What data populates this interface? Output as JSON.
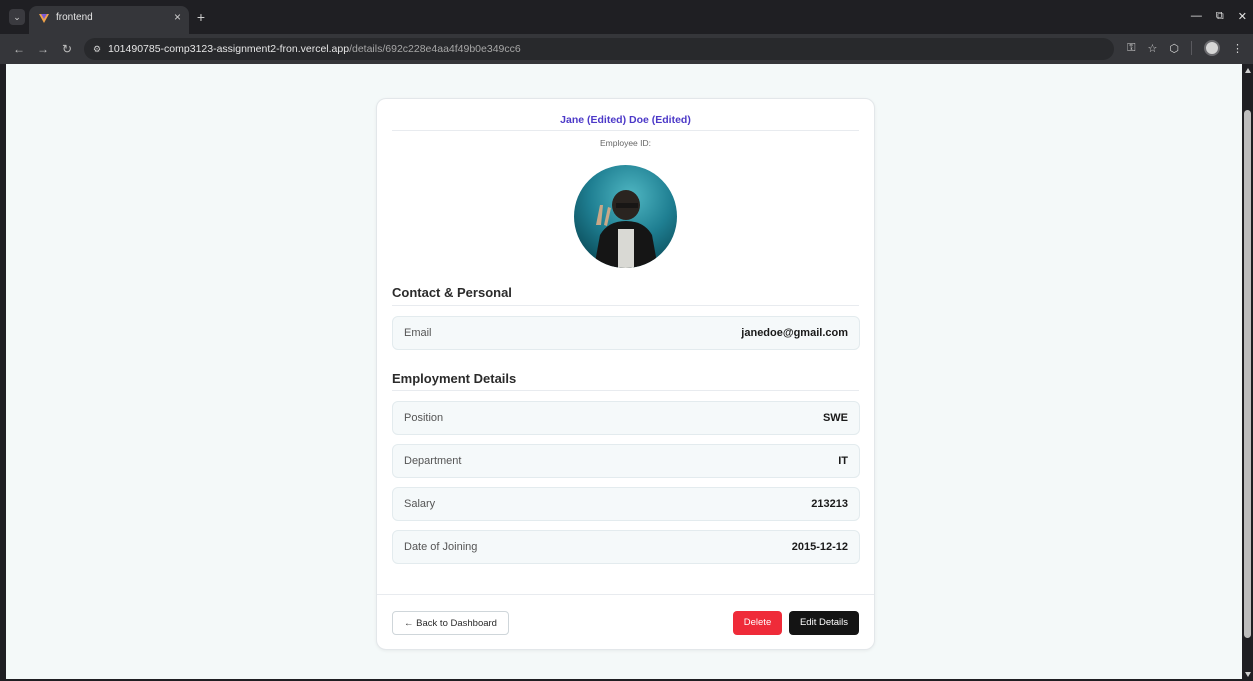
{
  "browser": {
    "tab_title": "frontend",
    "url_host": "101490785-comp3123-assignment2-fron.vercel.app",
    "url_path": "/details/692c228e4aa4f49b0e349cc6"
  },
  "employee": {
    "name": "Jane (Edited) Doe (Edited)",
    "id_label": "Employee ID:"
  },
  "sections": {
    "contact_title": "Contact & Personal",
    "employment_title": "Employment Details"
  },
  "fields": {
    "email": {
      "label": "Email",
      "value": "janedoe@gmail.com"
    },
    "position": {
      "label": "Position",
      "value": "SWE"
    },
    "department": {
      "label": "Department",
      "value": "IT"
    },
    "salary": {
      "label": "Salary",
      "value": "213213"
    },
    "joining": {
      "label": "Date of Joining",
      "value": "2015-12-12"
    }
  },
  "actions": {
    "back": "← Back to Dashboard",
    "delete": "Delete",
    "edit": "Edit Details"
  },
  "colors": {
    "accent": "#4c39c8",
    "danger": "#ef2b39",
    "dark": "#141414"
  }
}
